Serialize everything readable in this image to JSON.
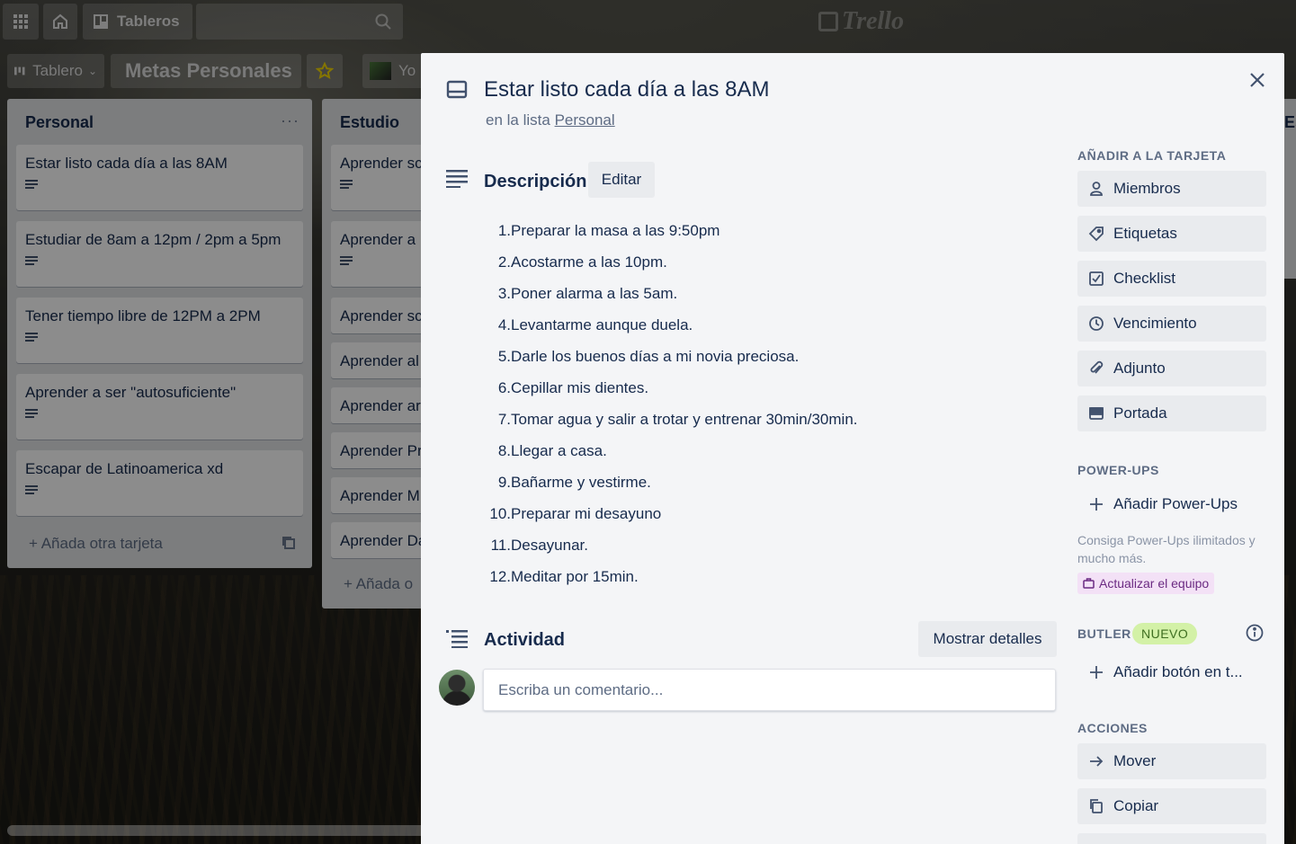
{
  "header": {
    "boards_label": "Tableros",
    "logo_text": "Trello"
  },
  "boardbar": {
    "view_label": "Tablero",
    "board_name": "Metas Personales",
    "member_label": "Yo"
  },
  "lists": [
    {
      "title": "Personal",
      "cards": [
        "Estar listo cada día a las 8AM",
        "Estudiar de 8am a 12pm / 2pm a 5pm",
        "Tener tiempo libre de 12PM a 2PM",
        "Aprender a ser \"autosuficiente\"",
        "Escapar de Latinoamerica xd"
      ],
      "add_card": "Añada otra tarjeta"
    },
    {
      "title": "Estudio",
      "cards": [
        "Aprender sc",
        "Aprender a",
        "Aprender sc",
        "Aprender al",
        "Aprender ar",
        "Aprender Pr",
        "Aprender M",
        "Aprender Da"
      ],
      "add_card": "Añada o"
    },
    {
      "title": "Es"
    }
  ],
  "modal": {
    "title": "Estar listo cada día a las 8AM",
    "in_list_prefix": "en la lista",
    "in_list_name": "Personal",
    "description_heading": "Descripción",
    "edit_label": "Editar",
    "steps": [
      "Preparar la masa a las 9:50pm",
      "Acostarme a las 10pm.",
      "Poner alarma a las 5am.",
      "Levantarme aunque duela.",
      "Darle los buenos días a mi novia preciosa.",
      "Cepillar mis dientes.",
      "Tomar agua y salir a trotar y entrenar 30min/30min.",
      "Llegar a casa.",
      "Bañarme y vestirme.",
      "Preparar mi desayuno",
      "Desayunar.",
      "Meditar por 15min."
    ],
    "activity_heading": "Actividad",
    "show_details_label": "Mostrar detalles",
    "comment_placeholder": "Escriba un comentario..."
  },
  "sidebar": {
    "add_heading": "AÑADIR A LA TARJETA",
    "add_items": [
      {
        "label": "Miembros",
        "icon": "person-icon"
      },
      {
        "label": "Etiquetas",
        "icon": "tag-icon"
      },
      {
        "label": "Checklist",
        "icon": "checkbox-icon"
      },
      {
        "label": "Vencimiento",
        "icon": "clock-icon"
      },
      {
        "label": "Adjunto",
        "icon": "paperclip-icon"
      },
      {
        "label": "Portada",
        "icon": "card-cover-icon"
      }
    ],
    "powerups_heading": "POWER-UPS",
    "add_powerups": "Añadir Power-Ups",
    "powerups_note": "Consiga Power-Ups ilimitados y mucho más.",
    "upgrade_label": "Actualizar el equipo",
    "butler_heading": "BUTLER",
    "butler_badge": "NUEVO",
    "add_button": "Añadir botón en t...",
    "actions_heading": "ACCIONES",
    "actions": [
      {
        "label": "Mover",
        "icon": "arrow-right-icon"
      },
      {
        "label": "Copiar",
        "icon": "copy-icon"
      }
    ]
  },
  "colors": {
    "modal_bg": "#f4f5f7",
    "text": "#172b4d",
    "muted": "#5e6c84",
    "button_bg": "#e9ebee",
    "badge_bg": "#d3f1a7",
    "upgrade_bg": "#f3e1f6"
  }
}
